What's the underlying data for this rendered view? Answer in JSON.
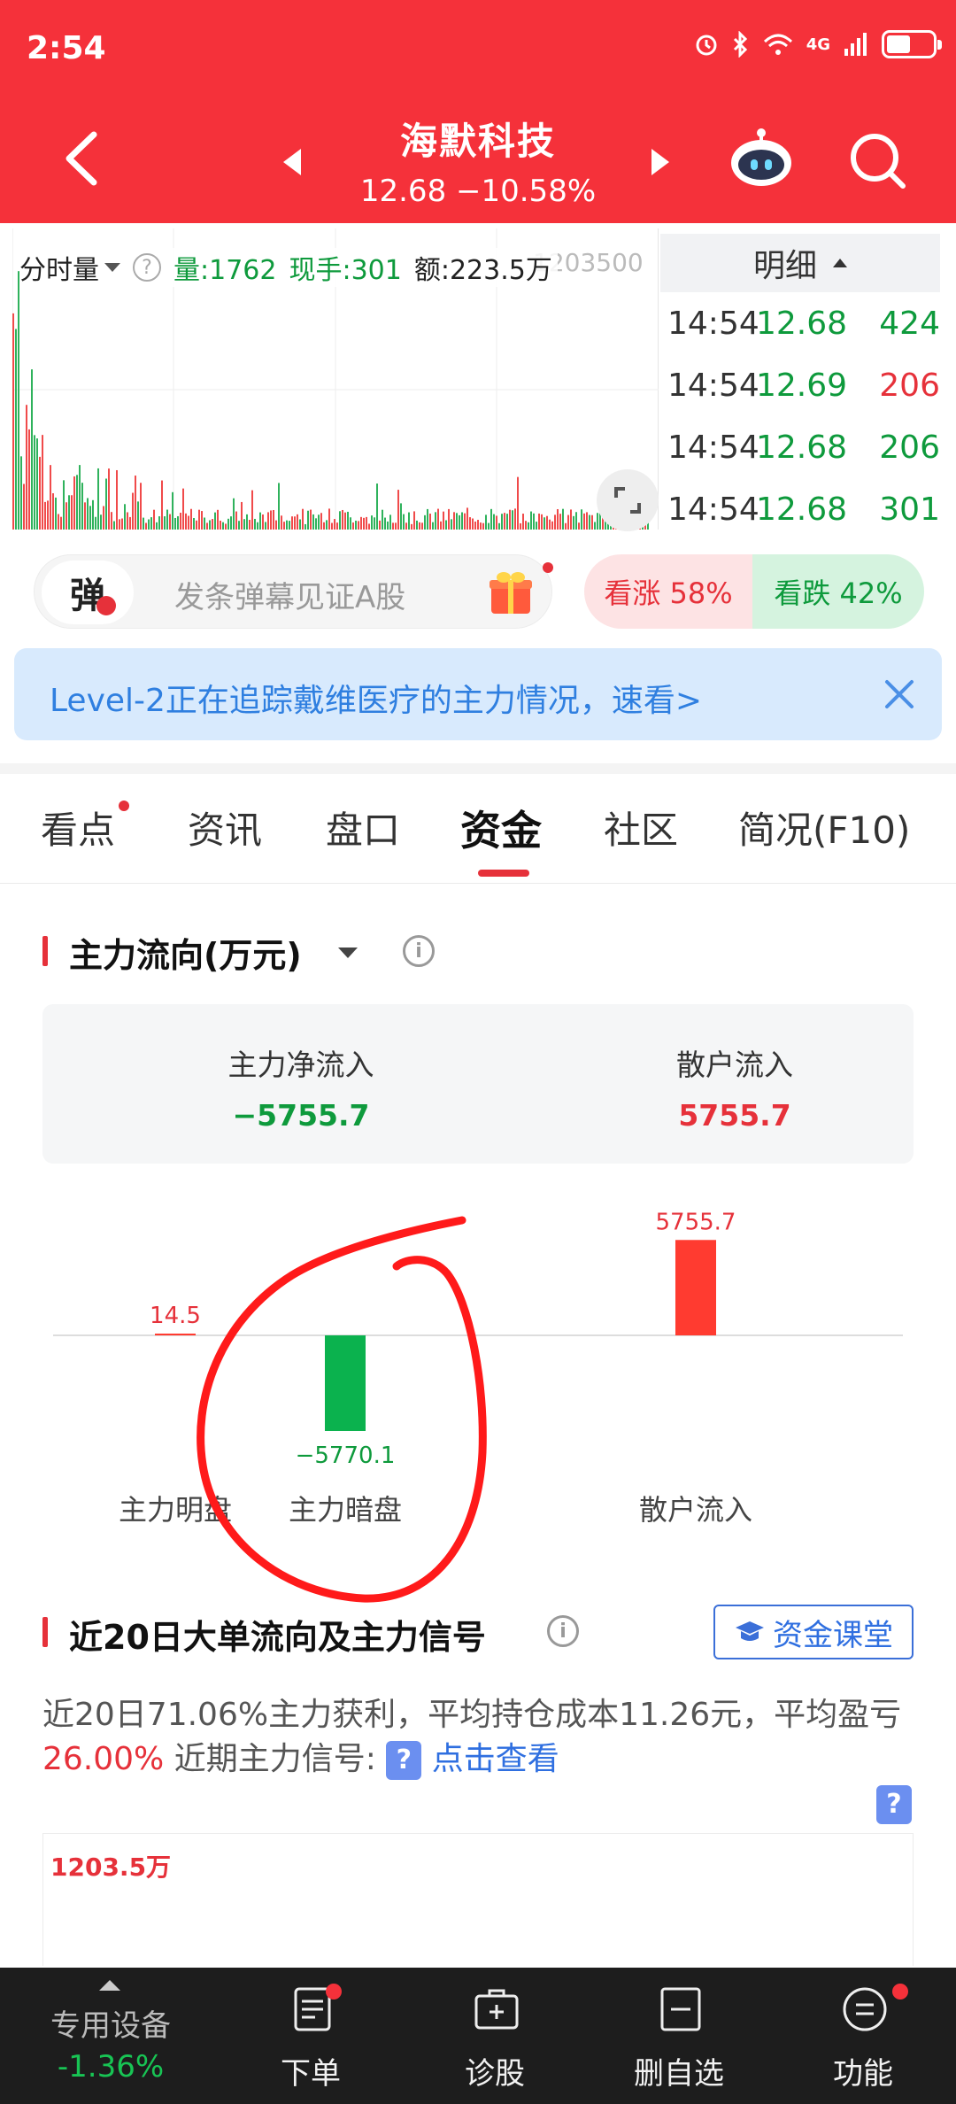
{
  "status": {
    "time": "2:54",
    "network": "4G"
  },
  "nav": {
    "stock_name": "海默科技",
    "stock_quote": "12.68 −10.58%"
  },
  "intraday": {
    "selector": "分时量",
    "volume_label": "量:1762",
    "current_label": "现手:301",
    "amount_label": "额:223.5万",
    "overlap_label": "1203500",
    "detail_header": "明细",
    "detail_rows": [
      {
        "time": "14:54",
        "price": "12.68",
        "volume": "424",
        "dir": "green"
      },
      {
        "time": "14:54",
        "price": "12.69",
        "volume": "206",
        "dir": "red"
      },
      {
        "time": "14:54",
        "price": "12.68",
        "volume": "206",
        "dir": "green"
      },
      {
        "time": "14:54",
        "price": "12.68",
        "volume": "301",
        "dir": "green"
      }
    ]
  },
  "danmu": {
    "icon_label": "弹",
    "placeholder": "发条弹幕见证A股",
    "vote_up": "看涨 58%",
    "vote_down": "看跌 42%"
  },
  "banner": {
    "text": "Level-2正在追踪戴维医疗的主力情况，速看>"
  },
  "tabs": [
    {
      "label": "看点"
    },
    {
      "label": "资讯"
    },
    {
      "label": "盘口"
    },
    {
      "label": "资金"
    },
    {
      "label": "社区"
    },
    {
      "label": "简况(F10)"
    }
  ],
  "main_flow": {
    "title": "主力流向(万元)",
    "net_inflow_label": "主力净流入",
    "net_inflow_value": "−5755.7",
    "retail_inflow_label": "散户流入",
    "retail_inflow_value": "5755.7"
  },
  "chart_data": {
    "type": "bar",
    "categories": [
      "主力明盘",
      "主力暗盘",
      "散户流入"
    ],
    "values": [
      14.5,
      -5770.1,
      5755.7
    ],
    "value_labels": [
      "14.5",
      "−5770.1",
      "5755.7"
    ],
    "colors": {
      "positive": "#ff3b30",
      "negative": "#0bb24e"
    },
    "title": "",
    "xlabel": "",
    "ylabel": ""
  },
  "signal": {
    "title": "近20日大单流向及主力信号",
    "course_label": "资金课堂",
    "text_part1": "近20日71.06%主力获利，平均持仓成本11.26元，平均盈亏",
    "text_percent": "26.00%",
    "text_part2": " 近期主力信号:",
    "q_badge": "?",
    "link": "点击查看",
    "chart_label": "1203.5万"
  },
  "bottom": {
    "device_name": "专用设备",
    "device_change": "-1.36%",
    "items": [
      {
        "label": "下单"
      },
      {
        "label": "诊股"
      },
      {
        "label": "删自选"
      },
      {
        "label": "功能"
      }
    ]
  },
  "colors": {
    "brand_red": "#f5313a",
    "up_red": "#e6313a",
    "down_green": "#0e9a3c",
    "link_blue": "#2f7fe0"
  }
}
